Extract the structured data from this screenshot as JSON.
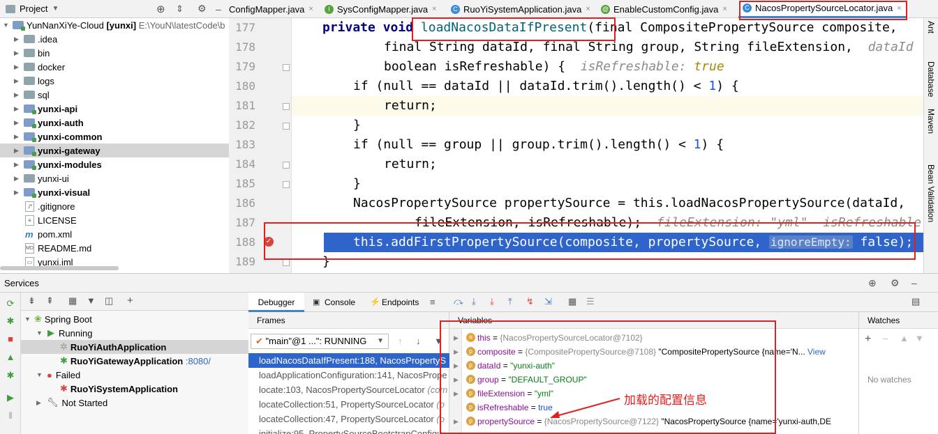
{
  "project": {
    "title": "Project",
    "root": {
      "name": "YunNanXiYe-Cloud",
      "module": "[yunxi]",
      "path": "E:\\YouN\\latestCode\\b"
    },
    "items": [
      {
        "label": "idea",
        "dot": ".",
        "kind": "folder",
        "bold": false
      },
      {
        "label": "bin",
        "kind": "folder",
        "bold": false
      },
      {
        "label": "docker",
        "kind": "folder",
        "bold": false
      },
      {
        "label": "logs",
        "kind": "folder",
        "bold": false
      },
      {
        "label": "sql",
        "kind": "folder",
        "bold": false
      },
      {
        "label": "yunxi-api",
        "kind": "module",
        "bold": true
      },
      {
        "label": "yunxi-auth",
        "kind": "module",
        "bold": true
      },
      {
        "label": "yunxi-common",
        "kind": "module",
        "bold": true
      },
      {
        "label": "yunxi-gateway",
        "kind": "module",
        "bold": true,
        "selected": true
      },
      {
        "label": "yunxi-modules",
        "kind": "module",
        "bold": true
      },
      {
        "label": "yunxi-ui",
        "kind": "folder",
        "bold": false
      },
      {
        "label": "yunxi-visual",
        "kind": "module",
        "bold": true
      }
    ],
    "files": [
      ".gitignore",
      "LICENSE",
      "pom.xml",
      "README.md",
      "yunxi.iml"
    ]
  },
  "tabs": [
    {
      "label": "ConfigMapper.java"
    },
    {
      "label": "SysConfigMapper.java"
    },
    {
      "label": "RuoYiSystemApplication.java"
    },
    {
      "label": "EnableCustomConfig.java"
    },
    {
      "label": "NacosPropertySourceLocator.java",
      "active": true
    }
  ],
  "editor": {
    "line_numbers": [
      "177",
      "178",
      "179",
      "180",
      "181",
      "182",
      "183",
      "184",
      "185",
      "186",
      "187",
      "188",
      "189"
    ],
    "lines": {
      "l177_a": "private void ",
      "l177_m": "loadNacosDataIfPresent",
      "l177_b": "(final CompositePropertySource composite,",
      "l178": "final String dataId, final String group, String fileExtension,",
      "l178_hint": "dataId",
      "l179": "boolean isRefreshable) {",
      "l179_hint": "isRefreshable:",
      "l179_hintv": "true",
      "l180_a": "if (null == dataId || dataId.trim().length() < ",
      "l180_n": "1",
      "l180_b": ") {",
      "l181": "return;",
      "l182": "}",
      "l183_a": "if (null == group || group.trim().length() < ",
      "l183_n": "1",
      "l183_b": ") {",
      "l184": "return;",
      "l185": "}",
      "l186": "NacosPropertySource propertySource = this.loadNacosPropertySource(dataId,",
      "l187": "fileExtension, isRefreshable);",
      "l187_hint": "fileExtension: \"yml\"  isRefreshable",
      "l188_a": "this.addFirstPropertySource(composite, propertySource, ",
      "l188_p": "ignoreEmpty:",
      "l188_b": " false);",
      "l189": "}"
    }
  },
  "rightbar": [
    "Ant",
    "Database",
    "Maven",
    "Bean Validation"
  ],
  "services": {
    "title": "Services",
    "tree": [
      {
        "label": "Spring Boot",
        "level": 0
      },
      {
        "label": "Running",
        "level": 1
      },
      {
        "label": "RuoYiAuthApplication",
        "level": 2,
        "selected": true
      },
      {
        "label": "RuoYiGatewayApplication",
        "port": ":8080/",
        "level": 2
      },
      {
        "label": "Failed",
        "level": 1
      },
      {
        "label": "RuoYiSystemApplication",
        "level": 2
      },
      {
        "label": "Not Started",
        "level": 1
      }
    ]
  },
  "debugger": {
    "tabs": {
      "debugger": "Debugger",
      "console": "Console",
      "endpoints": "Endpoints"
    },
    "frames_title": "Frames",
    "thread": "\"main\"@1 ...\": RUNNING",
    "frames": [
      {
        "method": "loadNacosDataIfPresent:188, NacosPropertyS",
        "cls": ""
      },
      {
        "method": "loadApplicationConfiguration:141, NacosPrope",
        "cls": ""
      },
      {
        "method": "locate:103, NacosPropertySourceLocator",
        "cls": "(com"
      },
      {
        "method": "locateCollection:51, PropertySourceLocator",
        "cls": "(o"
      },
      {
        "method": "locateCollection:47, PropertySourceLocator",
        "cls": "(o"
      },
      {
        "method": "initialize:95, PropertySourceBootstrapConfigu",
        "cls": ""
      }
    ],
    "variables_title": "Variables",
    "variables": [
      {
        "name": "this",
        "value": "{NacosPropertySourceLocator@7102}",
        "kind": "obj"
      },
      {
        "name": "composite",
        "value": "{CompositePropertySource@7108}",
        "extra": " \"CompositePropertySource {name='N...",
        "link": "View",
        "kind": "p"
      },
      {
        "name": "dataId",
        "value": "\"yunxi-auth\"",
        "kind": "p"
      },
      {
        "name": "group",
        "value": "\"DEFAULT_GROUP\"",
        "kind": "p"
      },
      {
        "name": "fileExtension",
        "value": "\"yml\"",
        "kind": "p"
      },
      {
        "name": "isRefreshable",
        "value": "true",
        "kind": "p"
      },
      {
        "name": "propertySource",
        "value": "{NacosPropertySource@7122}",
        "extra": " \"NacosPropertySource {name='yunxi-auth,DE",
        "kind": "p"
      }
    ],
    "annotation": "加载的配置信息",
    "watches_title": "Watches",
    "no_watches": "No watches"
  },
  "colors": {
    "highlight_line": "#2f65ca",
    "annotation": "#e02020",
    "selection": "#d5d5d5"
  }
}
